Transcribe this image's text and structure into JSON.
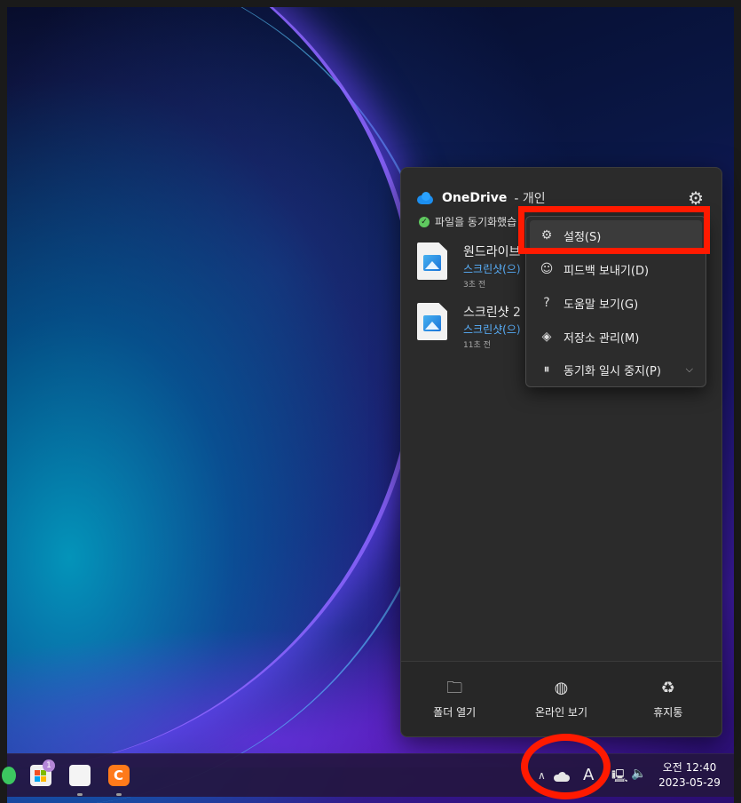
{
  "onedrive": {
    "title": "OneDrive",
    "subtitle": "- 개인",
    "status": "파일을 동기화했습",
    "files": [
      {
        "name": "원드라이브",
        "location": "스크린샷(으)",
        "time": "3초 전"
      },
      {
        "name": "스크린샷 2",
        "location": "스크린샷(으)",
        "time": "11초 전"
      }
    ],
    "footer": [
      {
        "label": "폴더 열기",
        "icon": "folder-icon"
      },
      {
        "label": "온라인 보기",
        "icon": "globe-icon"
      },
      {
        "label": "휴지통",
        "icon": "recycle-bin-icon"
      }
    ]
  },
  "menu": {
    "items": [
      {
        "label": "설정(S)",
        "icon": "gear-icon"
      },
      {
        "label": "피드백 보내기(D)",
        "icon": "feedback-icon"
      },
      {
        "label": "도움말 보기(G)",
        "icon": "help-icon"
      },
      {
        "label": "저장소 관리(M)",
        "icon": "layers-icon"
      },
      {
        "label": "동기화 일시 중지(P)",
        "icon": "pause-icon"
      }
    ]
  },
  "taskbar": {
    "store_badge": "1",
    "ime": "A",
    "time": "오전 12:40",
    "date": "2023-05-29"
  },
  "colors": {
    "highlight": "#ff1a00",
    "onedrive_blue": "#1c8ff0",
    "link_blue": "#5ab2ff"
  }
}
